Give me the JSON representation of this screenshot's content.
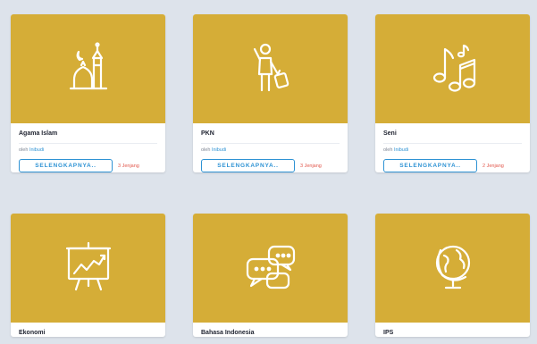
{
  "courses": [
    {
      "title": "Agama Islam",
      "by_prefix": "oleh",
      "author": "Inibudi",
      "button": "SELENGKAPNYA..",
      "level": "3 Jenjang",
      "icon": "mosque-icon"
    },
    {
      "title": "PKN",
      "by_prefix": "oleh",
      "author": "Inibudi",
      "button": "SELENGKAPNYA..",
      "level": "3 Jenjang",
      "icon": "traveler-icon"
    },
    {
      "title": "Seni",
      "by_prefix": "oleh",
      "author": "Inibudi",
      "button": "SELENGKAPNYA..",
      "level": "2 Jenjang",
      "icon": "music-notes-icon"
    },
    {
      "title": "Ekonomi",
      "icon": "presentation-chart-icon"
    },
    {
      "title": "Bahasa Indonesia",
      "icon": "chat-bubbles-icon"
    },
    {
      "title": "IPS",
      "icon": "globe-icon"
    }
  ],
  "colors": {
    "banner": "#d5ad37",
    "accent": "#2f93d4",
    "level": "#e2574c",
    "background": "#dde3eb"
  }
}
